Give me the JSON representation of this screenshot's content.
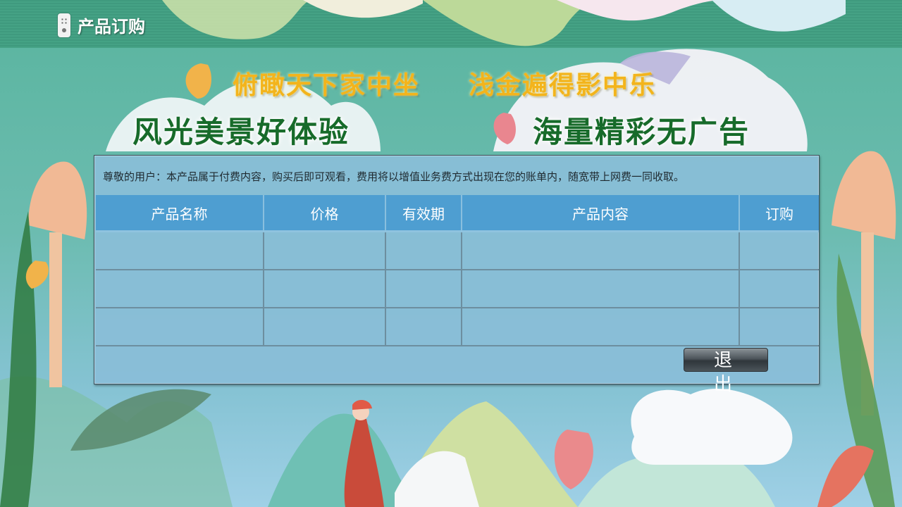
{
  "header": {
    "icon": "remote-control-icon",
    "title": "产品订购"
  },
  "slogans": {
    "line1_left": "俯瞰天下家中坐",
    "line1_right": "浅金遍得影中乐",
    "line2_left": "风光美景好体验",
    "line2_right": "海量精彩无广告"
  },
  "notice": "尊敬的用户：本产品属于付费内容，购买后即可观看，费用将以增值业务费方式出现在您的账单内，随宽带上网费一同收取。",
  "table": {
    "headers": [
      "产品名称",
      "价格",
      "有效期",
      "产品内容",
      "订购"
    ],
    "rows": [
      [
        "",
        "",
        "",
        "",
        ""
      ],
      [
        "",
        "",
        "",
        "",
        ""
      ],
      [
        "",
        "",
        "",
        "",
        ""
      ]
    ]
  },
  "buttons": {
    "exit": "退 出"
  },
  "colors": {
    "header_bg": "#45a285",
    "slogan_gold": "#f3b41c",
    "slogan_green": "#176b2a",
    "panel_bg": "#8abed8",
    "table_header": "#4e9ed1"
  }
}
